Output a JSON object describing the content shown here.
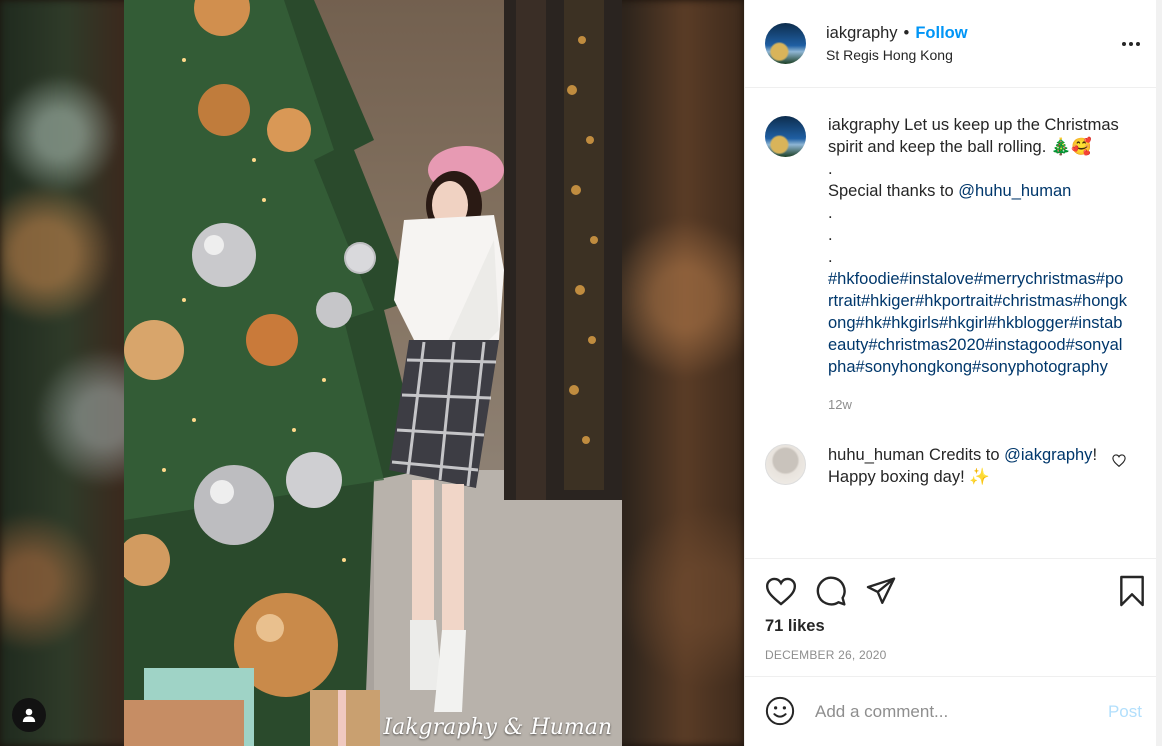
{
  "header": {
    "username": "iakgraphy",
    "separator": "•",
    "follow_label": "Follow",
    "location": "St Regis Hong Kong"
  },
  "photo": {
    "watermark": "Iakgraphy & Human"
  },
  "caption": {
    "username": "iakgraphy",
    "text_part1": "Let us keep up the Christmas spirit and keep the ball rolling. 🎄🥰\n.\nSpecial thanks to ",
    "mention": "@huhu_human",
    "text_part2": "\n.\n.\n.\n",
    "hashtags": "#hkfoodie#instalove#merrychristmas#portrait#hkiger#hkportrait#christmas#hongkong#hk#hkgirls#hkgirl#hkblogger#instabeauty#christmas2020#instagood#sonyalpha#sonyhongkong#sonyphotography",
    "age": "12w"
  },
  "comment": {
    "username": "huhu_human",
    "text_part1": "Credits to",
    "mention": "@iakgraphy",
    "text_part2": "! Happy boxing day! ✨"
  },
  "actions": {
    "likes": "71 likes",
    "date": "DECEMBER 26, 2020"
  },
  "add_comment": {
    "placeholder": "Add a comment...",
    "post_label": "Post"
  },
  "colors": {
    "accent": "#0095f6",
    "link": "#00376b",
    "muted": "#8e8e8e",
    "post_disabled": "#b2dffc"
  }
}
